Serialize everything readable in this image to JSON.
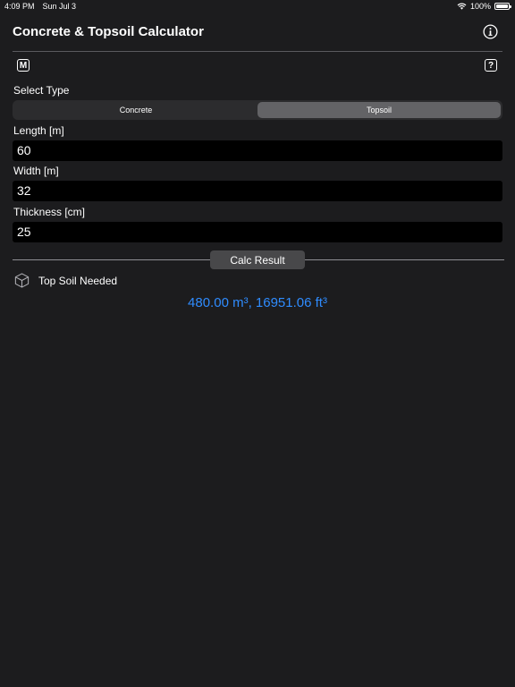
{
  "status_bar": {
    "time": "4:09 PM",
    "date": "Sun Jul 3",
    "battery_text": "100%",
    "battery_level": 1.0,
    "wifi_icon": "wifi-icon",
    "battery_icon": "battery-icon"
  },
  "header": {
    "title": "Concrete & Topsoil Calculator",
    "info_icon": "info-icon",
    "m_label": "M",
    "help_label": "?"
  },
  "type_selector": {
    "label": "Select Type",
    "options": [
      "Concrete",
      "Topsoil"
    ],
    "selected": "Topsoil"
  },
  "fields": {
    "length": {
      "label": "Length [m]",
      "value": "60"
    },
    "width": {
      "label": "Width [m]",
      "value": "32"
    },
    "thickness": {
      "label": "Thickness [cm]",
      "value": "25"
    }
  },
  "calc_button_label": "Calc Result",
  "result": {
    "icon": "cube-icon",
    "label": "Top Soil Needed",
    "value": "480.00 m³, 16951.06 ft³"
  },
  "colors": {
    "background": "#1c1c1e",
    "accent": "#2f8cff",
    "input_background": "#000000",
    "segment_selected": "#636366"
  }
}
